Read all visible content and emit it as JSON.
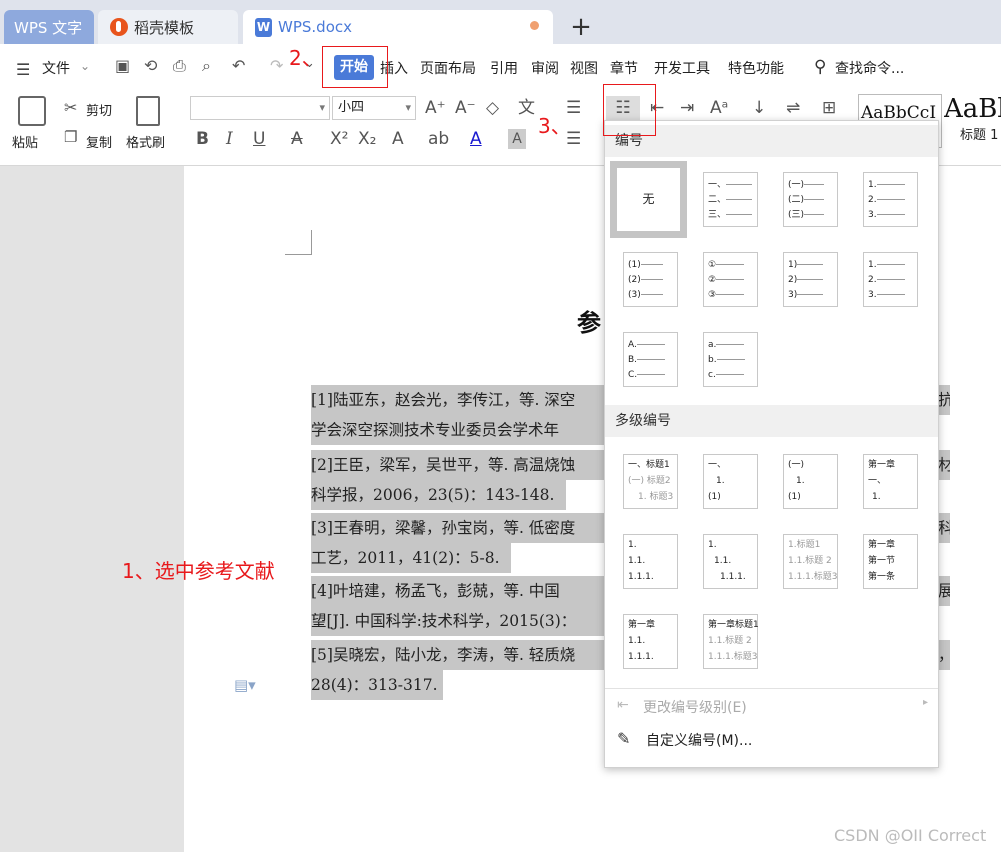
{
  "tabs": {
    "wps": "WPS 文字",
    "template": "稻壳模板",
    "doc": "WPS.docx",
    "doc_icon": "W",
    "new_tab": "+"
  },
  "menubar": {
    "file": "文件",
    "items": [
      "开始",
      "插入",
      "页面布局",
      "引用",
      "审阅",
      "视图",
      "章节",
      "开发工具",
      "特色功能"
    ],
    "search": "查找命令..."
  },
  "ribbon": {
    "paste": "粘贴",
    "cut": "剪切",
    "copy": "复制",
    "format_painter": "格式刷",
    "font_name": "",
    "font_size": "小四",
    "style_preview1": "AaBbCcI",
    "style_preview2": "AaBl",
    "style_label": "标题 1"
  },
  "document": {
    "title_partial": "参",
    "refs": [
      "[1]陆亚东，赵会光，李传江，等. 深空",
      "学会深空探测技术专业委员会学术年",
      "[2]王臣，梁军，吴世平，等. 高温烧蚀",
      "科学报，2006，23(5)：143-148.",
      "[3]王春明，梁馨，孙宝岗，等. 低密度",
      "工艺，2011，41(2)：5-8.",
      "[4]叶培建，杨孟飞，彭兢，等. 中国",
      "望[J]. 中国科学:技术科学，2015(3)：",
      "[5]吴晓宏，陆小龙，李涛，等. 轻质烧",
      "28(4)：313-317."
    ],
    "right_cut": [
      "抗",
      "材",
      "科",
      "展",
      "，"
    ]
  },
  "dropdown": {
    "numbering_header": "编号",
    "none_label": "无",
    "multilevel_header": "多级编号",
    "change_level": "更改编号级别(E)",
    "custom": "自定义编号(M)...",
    "numbering": [
      [
        "一、",
        "二、",
        "三、"
      ],
      [
        "(一)",
        "(二)",
        "(三)"
      ],
      [
        "1.",
        "2.",
        "3."
      ],
      [
        "(1)",
        "(2)",
        "(3)"
      ],
      [
        "①",
        "②",
        "③"
      ],
      [
        "1)",
        "2)",
        "3)"
      ],
      [
        "1.",
        "2.",
        "3."
      ],
      [
        "A.",
        "B.",
        "C."
      ],
      [
        "a.",
        "b.",
        "c."
      ]
    ],
    "multilevel": [
      [
        "一、标题1",
        "(一) 标题2",
        "1. 标题3"
      ],
      [
        "一、",
        "1.",
        "(1)"
      ],
      [
        "(一)",
        "1.",
        "(1)"
      ],
      [
        "第一章",
        "一、",
        "1."
      ],
      [
        "1.",
        "1.1.",
        "1.1.1."
      ],
      [
        "1.",
        "1.1.",
        "1.1.1."
      ],
      [
        "1.标题1",
        "1.1.标题 2",
        "1.1.1.标题3"
      ],
      [
        "第一章",
        "第一节",
        "第一条"
      ],
      [
        "第一章",
        "1.1.",
        "1.1.1."
      ],
      [
        "第一章标题1",
        "1.1.标题 2",
        "1.1.1.标题3"
      ]
    ]
  },
  "annotations": {
    "step1": "1、选中参考文献",
    "step2": "2、",
    "step3": "3、"
  },
  "watermark": "CSDN @OII Correct",
  "colors": {
    "accent": "#4a7ad8",
    "annotation": "#e8191c",
    "selection": "#c6c6c6"
  }
}
